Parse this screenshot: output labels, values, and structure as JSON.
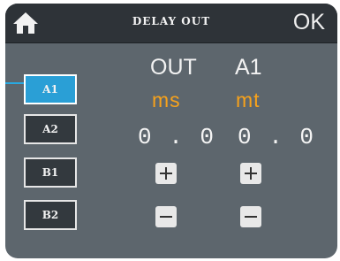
{
  "header": {
    "title": "DELAY OUT",
    "ok_label": "OK",
    "home_icon": "home-icon"
  },
  "channels": [
    {
      "label": "A1",
      "active": true
    },
    {
      "label": "A2",
      "active": false
    },
    {
      "label": "B1",
      "active": false
    },
    {
      "label": "B2",
      "active": false
    }
  ],
  "main": {
    "out_label": "OUT",
    "out_channel": "A1",
    "ms_unit": "ms",
    "mt_unit": "mt",
    "ms_value": "0.0",
    "mt_value": "0.0"
  },
  "colors": {
    "accent": "#2a9fd6",
    "unit": "#f7a21b",
    "panel": "#5d666d",
    "titlebar": "#2e3338"
  }
}
